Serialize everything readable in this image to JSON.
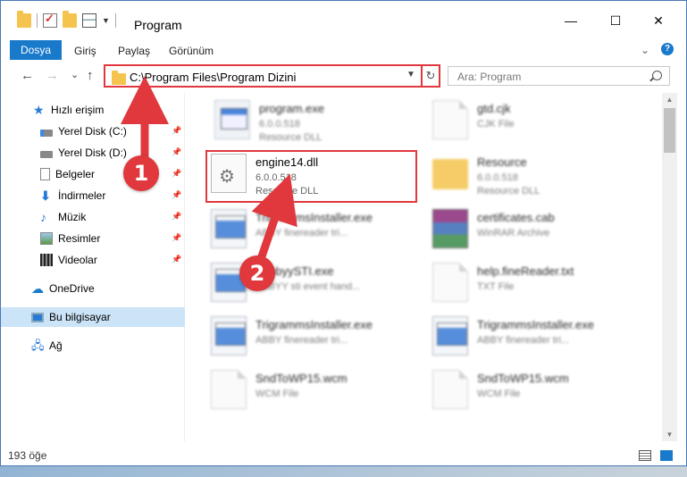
{
  "window": {
    "title": "Program",
    "controls": {
      "minimize": "—",
      "maximize": "☐",
      "close": "✕"
    }
  },
  "ribbon": {
    "tabs": [
      {
        "label": "Dosya",
        "active": true
      },
      {
        "label": "Giriş"
      },
      {
        "label": "Paylaş"
      },
      {
        "label": "Görünüm"
      }
    ],
    "help": "?"
  },
  "nav": {
    "back": "←",
    "forward": "→",
    "recent": "⌄",
    "up": "↑",
    "address": "C:\\Program Files\\Program Dizini",
    "refresh": "↻",
    "search_placeholder": "Ara: Program"
  },
  "sidebar": {
    "items": [
      {
        "label": "Hızlı erişim",
        "icon": "star-icon"
      },
      {
        "label": "Yerel Disk (C:)",
        "icon": "drive-icon",
        "pinned": true
      },
      {
        "label": "Yerel Disk (D:)",
        "icon": "drive-icon",
        "pinned": true
      },
      {
        "label": "Belgeler",
        "icon": "documents-icon",
        "pinned": true
      },
      {
        "label": "İndirmeler",
        "icon": "downloads-icon",
        "pinned": true
      },
      {
        "label": "Müzik",
        "icon": "music-icon",
        "pinned": true
      },
      {
        "label": "Resimler",
        "icon": "pictures-icon",
        "pinned": true
      },
      {
        "label": "Videolar",
        "icon": "videos-icon",
        "pinned": true
      },
      {
        "label": "OneDrive",
        "icon": "onedrive-icon"
      },
      {
        "label": "Bu bilgisayar",
        "icon": "computer-icon",
        "selected": true
      },
      {
        "label": "Ağ",
        "icon": "network-icon"
      }
    ]
  },
  "files": [
    {
      "name": "program.exe",
      "version": "6.0.0.518",
      "type": "Resource DLL",
      "icon": "app-icon"
    },
    {
      "name": "gtd.cjk",
      "version": "",
      "type": "CJK File",
      "icon": "page-icon"
    },
    {
      "name": "engine14.dll",
      "version": "6.0.0.518",
      "type": "Resource DLL",
      "icon": "gear-file-icon",
      "highlighted": true
    },
    {
      "name": "Resource",
      "version": "6.0.0.518",
      "type": "Resource DLL",
      "icon": "folder-icon"
    },
    {
      "name": "TrigrammsInstaller.exe",
      "version": "",
      "type": "ABBY finereader tri...",
      "icon": "exe-icon"
    },
    {
      "name": "certificates.cab",
      "version": "",
      "type": "WinRAR Archive",
      "icon": "winrar-icon"
    },
    {
      "name": "ZabbyySTI.exe",
      "version": "",
      "type": "ABBYY sti event hand...",
      "icon": "exe-icon"
    },
    {
      "name": "help.fineReader.txt",
      "version": "",
      "type": "TXT File",
      "icon": "page-icon"
    },
    {
      "name": "TrigrammsInstaller.exe",
      "version": "",
      "type": "ABBY finereader tri...",
      "icon": "exe-icon"
    },
    {
      "name": "TrigrammsInstaller.exe",
      "version": "",
      "type": "ABBY finereader tri...",
      "icon": "exe-icon"
    },
    {
      "name": "SndToWP15.wcm",
      "version": "",
      "type": "WCM File",
      "icon": "page-icon"
    },
    {
      "name": "SndToWP15.wcm",
      "version": "",
      "type": "WCM File",
      "icon": "page-icon"
    }
  ],
  "status": {
    "count": "193 öğe"
  },
  "callouts": [
    "1",
    "2"
  ],
  "colors": {
    "accent": "#1979ca",
    "callout": "#e0383c"
  }
}
